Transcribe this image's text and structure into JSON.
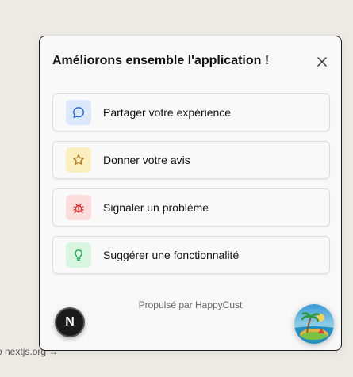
{
  "page": {
    "link_text": "o nextjs.org →"
  },
  "popup": {
    "title": "Améliorons ensemble l'application !",
    "options": [
      {
        "label": "Partager votre expérience",
        "icon": "chat-bubble-icon",
        "icon_color": "#2563eb",
        "bg_color": "#dbe7fb"
      },
      {
        "label": "Donner votre avis",
        "icon": "star-icon",
        "icon_color": "#b7791f",
        "bg_color": "#fbefbf"
      },
      {
        "label": "Signaler un problème",
        "icon": "bug-icon",
        "icon_color": "#dc2626",
        "bg_color": "#fbdcdc"
      },
      {
        "label": "Suggérer une fonctionnalité",
        "icon": "lightbulb-icon",
        "icon_color": "#16a34a",
        "bg_color": "#d7f5df"
      }
    ],
    "footer": "Propulsé par HappyCust"
  },
  "nextjs_badge": {
    "letter": "N"
  },
  "colors": {
    "background": "#ebeae4",
    "popup_bg": "#f8f8f9",
    "border": "#1d1d1f"
  }
}
